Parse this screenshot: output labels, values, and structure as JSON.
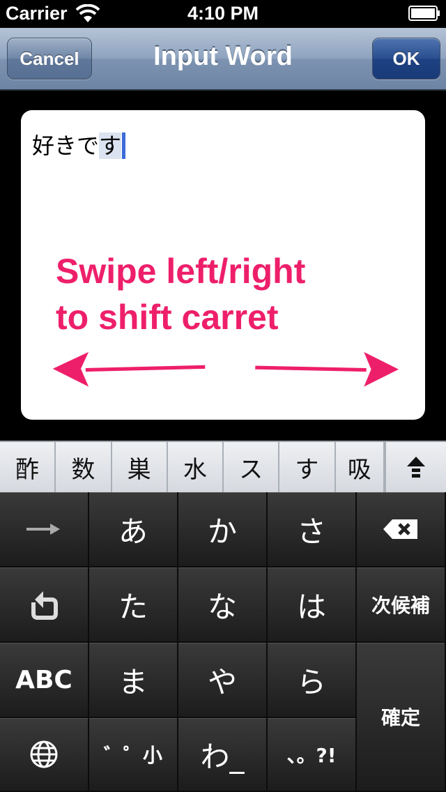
{
  "status": {
    "carrier": "Carrier",
    "time": "4:10 PM"
  },
  "nav": {
    "title": "Input Word",
    "cancel": "Cancel",
    "ok": "OK"
  },
  "editor": {
    "text_before": "好きで",
    "text_selected": "す"
  },
  "annotation": {
    "line1": "Swipe left/right",
    "line2": "to shift carret",
    "color": "#ee1f6a"
  },
  "candidates": [
    "酢",
    "数",
    "巣",
    "水",
    "ス",
    "す",
    "吸"
  ],
  "keyboard": {
    "row1": [
      "あ",
      "か",
      "さ"
    ],
    "row2": [
      "た",
      "な",
      "は"
    ],
    "row3": [
      "ま",
      "や",
      "ら"
    ],
    "row4": [
      "゛゜小",
      "わ_",
      "、。?!"
    ],
    "abc": "ABC",
    "next_candidate": "次候補",
    "confirm": "確定"
  }
}
